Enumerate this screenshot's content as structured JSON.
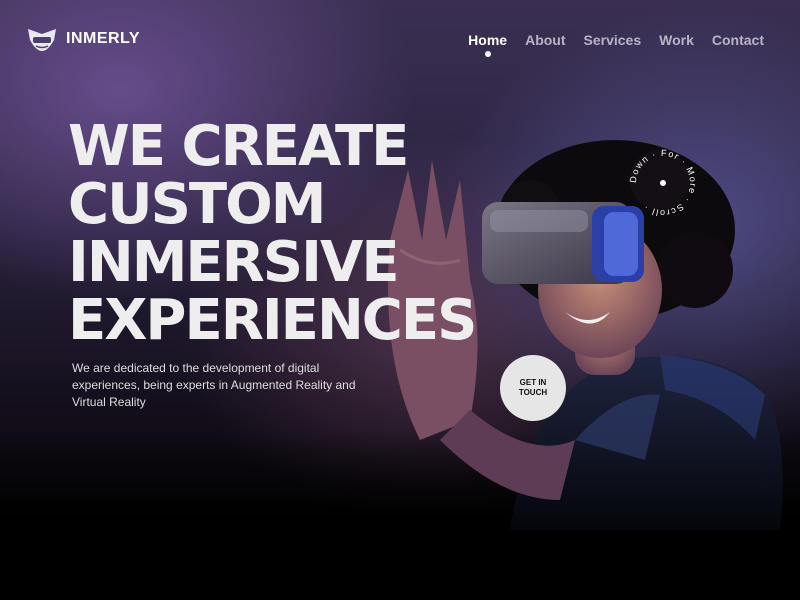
{
  "brand": {
    "name": "INMERLY",
    "logo_icon": "vr-headset-shield-icon"
  },
  "nav": {
    "items": [
      {
        "label": "Home",
        "active": true
      },
      {
        "label": "About",
        "active": false
      },
      {
        "label": "Services",
        "active": false
      },
      {
        "label": "Work",
        "active": false
      },
      {
        "label": "Contact",
        "active": false
      }
    ]
  },
  "hero": {
    "headline_lines": [
      "WE CREATE",
      "CUSTOM",
      "INMERSIVE",
      "EXPERIENCES"
    ],
    "description": "We are dedicated to the development of digital experiences, being experts in Augmented Reality and Virtual Reality",
    "cta_label": "GET IN TOUCH",
    "scroll_text": "Down · For · More · Scroll · "
  },
  "colors": {
    "headline": "#eeeeee",
    "nav_active": "#ffffff",
    "nav_inactive": "#b9b3c6",
    "cta_bg": "#e6e6e6"
  }
}
